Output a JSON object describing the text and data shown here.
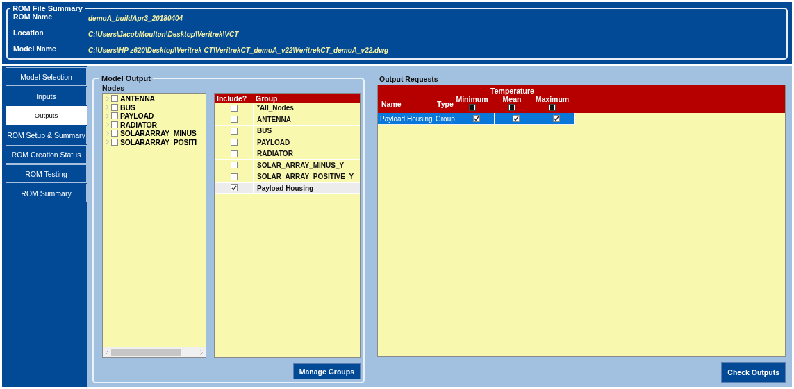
{
  "rom_file_summary": {
    "title": "ROM File Summary",
    "fields": [
      {
        "label": "ROM Name",
        "value": "demoA_buildApr3_20180404"
      },
      {
        "label": "Location",
        "value": "C:\\Users\\JacobMoulton\\Desktop\\Veritrek\\VCT"
      },
      {
        "label": "Model Name",
        "value": "C:\\Users\\HP z620\\Desktop\\Veritrek CT\\VeritrekCT_demoA_v22\\VeritrekCT_demoA_v22.dwg"
      }
    ]
  },
  "sidebar": {
    "items": [
      {
        "label": "Model Selection",
        "selected": false
      },
      {
        "label": "Inputs",
        "selected": false
      },
      {
        "label": "Outputs",
        "selected": true
      },
      {
        "label": "ROM Setup & Summary",
        "selected": false
      },
      {
        "label": "ROM Creation Status",
        "selected": false
      },
      {
        "label": "ROM Testing",
        "selected": false
      },
      {
        "label": "ROM Summary",
        "selected": false
      }
    ]
  },
  "model_output": {
    "title": "Model Output",
    "nodes": {
      "label": "Nodes",
      "items": [
        {
          "label": "ANTENNA",
          "checked": false,
          "expanded": false
        },
        {
          "label": "BUS",
          "checked": false,
          "expanded": false
        },
        {
          "label": "PAYLOAD",
          "checked": false,
          "expanded": false
        },
        {
          "label": "RADIATOR",
          "checked": false,
          "expanded": false
        },
        {
          "label": "SOLARARRAY_MINUS_",
          "checked": false,
          "expanded": false
        },
        {
          "label": "SOLARARRAY_POSITI",
          "checked": false,
          "expanded": false
        }
      ]
    },
    "groups": {
      "columns": [
        "Include?",
        "Group"
      ],
      "rows": [
        {
          "name": "*All_Nodes",
          "checked": false,
          "selected": false
        },
        {
          "name": "ANTENNA",
          "checked": false,
          "selected": false
        },
        {
          "name": "BUS",
          "checked": false,
          "selected": false
        },
        {
          "name": "PAYLOAD",
          "checked": false,
          "selected": false
        },
        {
          "name": "RADIATOR",
          "checked": false,
          "selected": false
        },
        {
          "name": "SOLAR_ARRAY_MINUS_Y",
          "checked": false,
          "selected": false
        },
        {
          "name": "SOLAR_ARRAY_POSITIVE_Y",
          "checked": false,
          "selected": false
        },
        {
          "name": "Payload Housing",
          "checked": true,
          "selected": true
        }
      ]
    },
    "button": "Manage Groups"
  },
  "output_requests": {
    "title": "Output Requests",
    "columns": [
      "Name",
      "Type"
    ],
    "temperature": {
      "label": "Temperature",
      "columns": [
        {
          "label": "Minimum",
          "indeterminate": true
        },
        {
          "label": "Mean",
          "indeterminate": true
        },
        {
          "label": "Maximum",
          "indeterminate": true
        }
      ]
    },
    "rows": [
      {
        "name": "Payload Housing",
        "type": "Group",
        "selected": true,
        "checks": [
          {
            "checked": true
          },
          {
            "checked": true
          },
          {
            "checked": true
          }
        ]
      }
    ]
  },
  "check_button": "Check Outputs"
}
